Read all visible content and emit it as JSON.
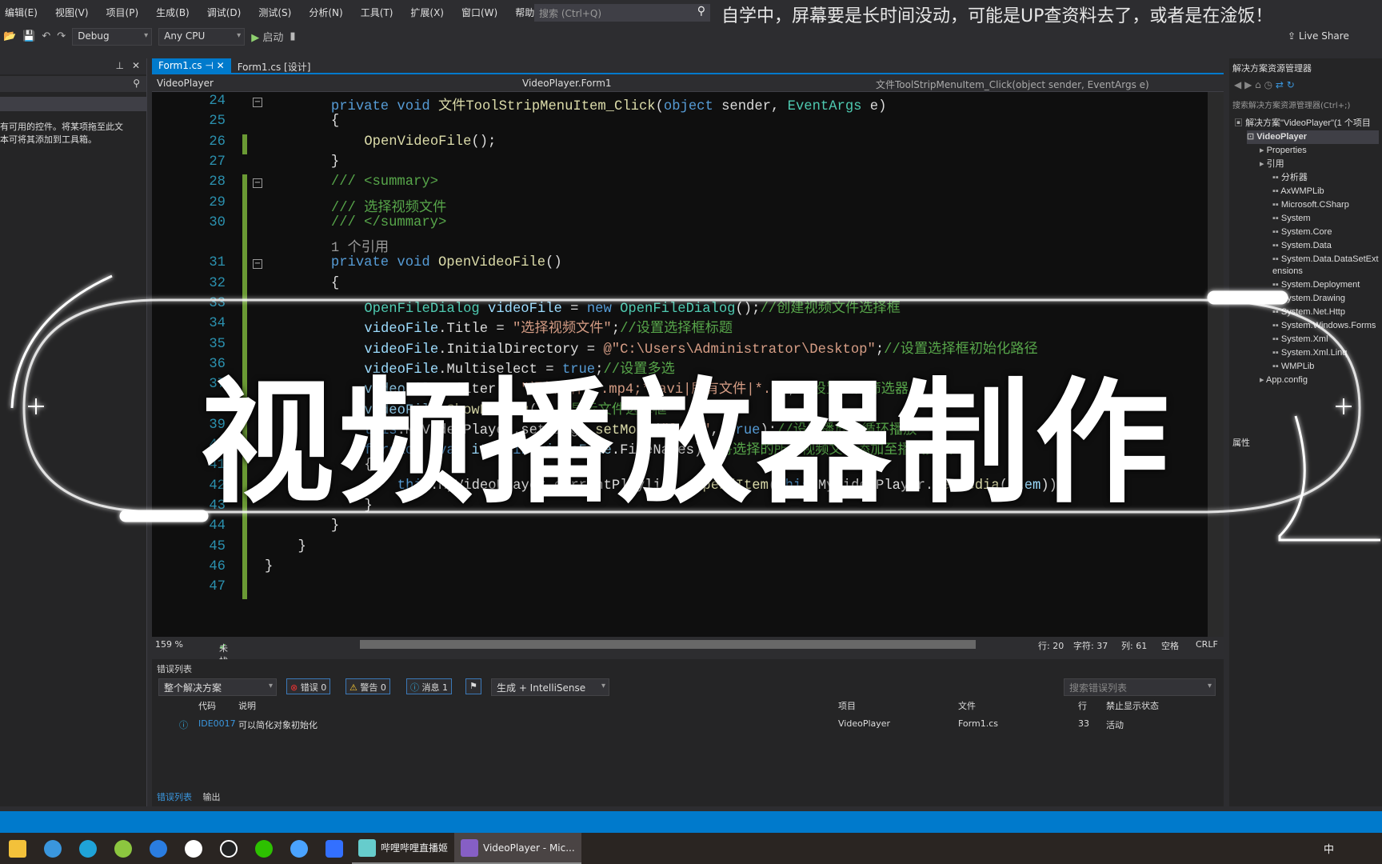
{
  "menu": [
    "编辑(E)",
    "视图(V)",
    "项目(P)",
    "生成(B)",
    "调试(D)",
    "测试(S)",
    "分析(N)",
    "工具(T)",
    "扩展(X)",
    "窗口(W)",
    "帮助(H)"
  ],
  "search": {
    "placeholder": "搜索 (Ctrl+Q)",
    "icon": "search-icon"
  },
  "banner": "自学中，屏幕要是长时间没动，可能是UP查资料去了，或者是在淦饭！",
  "toolbar": {
    "config": "Debug",
    "platform": "Any CPU",
    "start": "启动",
    "live_share": "Live Share"
  },
  "left_panel": {
    "message": [
      "有可用的控件。将某项拖至此文",
      "本可将其添加到工具箱。"
    ]
  },
  "tabs": [
    {
      "label": "Form1.cs",
      "active": true
    },
    {
      "label": "Form1.cs [设计]",
      "active": false
    }
  ],
  "nav": {
    "project": "VideoPlayer",
    "class": "VideoPlayer.Form1",
    "member": "文件ToolStripMenuItem_Click(object sender, EventArgs e)"
  },
  "code": [
    {
      "n": "24",
      "i": 8,
      "t": [
        [
          "private void ",
          "k"
        ],
        [
          "文件ToolStripMenuItem_Click",
          "m"
        ],
        [
          "(",
          "p"
        ],
        [
          "object ",
          "k"
        ],
        [
          "sender, ",
          "p"
        ],
        [
          "EventArgs ",
          "ty"
        ],
        [
          "e)",
          "p"
        ]
      ]
    },
    {
      "n": "25",
      "i": 8,
      "t": [
        [
          "{",
          "p"
        ]
      ]
    },
    {
      "n": "26",
      "i": 12,
      "t": [
        [
          "OpenVideoFile",
          "m"
        ],
        [
          "();",
          "p"
        ]
      ]
    },
    {
      "n": "27",
      "i": 8,
      "t": [
        [
          "}",
          "p"
        ]
      ]
    },
    {
      "n": "28",
      "i": 8,
      "t": [
        [
          "/// <summary>",
          "c"
        ]
      ]
    },
    {
      "n": "29",
      "i": 8,
      "t": [
        [
          "/// 选择视频文件",
          "c"
        ]
      ]
    },
    {
      "n": "30",
      "i": 8,
      "t": [
        [
          "/// </summary>",
          "c"
        ]
      ]
    },
    {
      "n": "",
      "i": 8,
      "t": [
        [
          "1 个引用",
          "g"
        ]
      ]
    },
    {
      "n": "31",
      "i": 8,
      "t": [
        [
          "private void ",
          "k"
        ],
        [
          "OpenVideoFile",
          "m"
        ],
        [
          "()",
          "p"
        ]
      ]
    },
    {
      "n": "32",
      "i": 8,
      "t": [
        [
          "{",
          "p"
        ]
      ]
    },
    {
      "n": "33",
      "i": 12,
      "t": [
        [
          "OpenFileDialog ",
          "ty"
        ],
        [
          "videoFile",
          "v"
        ],
        [
          " = ",
          "p"
        ],
        [
          "new ",
          "k"
        ],
        [
          "OpenFileDialog",
          "ty"
        ],
        [
          "();",
          "p"
        ],
        [
          "//创建视频文件选择框",
          "c"
        ]
      ]
    },
    {
      "n": "34",
      "i": 12,
      "t": [
        [
          "videoFile",
          "v"
        ],
        [
          ".Title = ",
          "p"
        ],
        [
          "\"选择视频文件\"",
          "s"
        ],
        [
          ";",
          "p"
        ],
        [
          "//设置选择框标题",
          "c"
        ]
      ]
    },
    {
      "n": "35",
      "i": 12,
      "t": [
        [
          "videoFile",
          "v"
        ],
        [
          ".InitialDirectory = ",
          "p"
        ],
        [
          "@\"C:\\Users\\Administrator\\Desktop\"",
          "s"
        ],
        [
          ";",
          "p"
        ],
        [
          "//设置选择框初始化路径",
          "c"
        ]
      ]
    },
    {
      "n": "36",
      "i": 12,
      "t": [
        [
          "videoFile",
          "v"
        ],
        [
          ".Multiselect = ",
          "p"
        ],
        [
          "true",
          "k"
        ],
        [
          ";",
          "p"
        ],
        [
          "//设置多选",
          "c"
        ]
      ]
    },
    {
      "n": "37",
      "i": 12,
      "t": [
        [
          "videoFile",
          "v"
        ],
        [
          ".Filter = ",
          "p"
        ],
        [
          "\"视频文件|*.mp4;*.avi|所有文件|*.*\"",
          "s"
        ],
        [
          ";",
          "p"
        ],
        [
          "//设置文件筛选器",
          "c"
        ]
      ]
    },
    {
      "n": "38",
      "i": 12,
      "t": [
        [
          "videoFile",
          "v"
        ],
        [
          ".",
          "p"
        ],
        [
          "ShowDialog",
          "m"
        ],
        [
          "();",
          "p"
        ],
        [
          "//显示文件选择框",
          "c"
        ]
      ]
    },
    {
      "n": "39",
      "i": 12,
      "t": [
        [
          "this",
          "k"
        ],
        [
          ".MyVideoPlayer.settings.",
          "p"
        ],
        [
          "setMode",
          "m"
        ],
        [
          "(",
          "p"
        ],
        [
          "\"loop\"",
          "s"
        ],
        [
          ", ",
          "p"
        ],
        [
          "true",
          "k"
        ],
        [
          ");",
          "p"
        ],
        [
          "//设置播放器循环播放",
          "c"
        ]
      ]
    },
    {
      "n": "40",
      "i": 12,
      "t": [
        [
          "foreach ",
          "k"
        ],
        [
          "(",
          "p"
        ],
        [
          "var ",
          "k"
        ],
        [
          "item ",
          "v"
        ],
        [
          "in ",
          "k"
        ],
        [
          "videoFile",
          "v"
        ],
        [
          ".FileNames)",
          "p"
        ],
        [
          "//将选择的所有视频文件添加至播放列表",
          "c"
        ]
      ]
    },
    {
      "n": "41",
      "i": 12,
      "t": [
        [
          "{",
          "p"
        ]
      ]
    },
    {
      "n": "42",
      "i": 16,
      "t": [
        [
          "this",
          "k"
        ],
        [
          ".MyVideoPlayer.currentPlaylist.",
          "p"
        ],
        [
          "appendItem",
          "m"
        ],
        [
          "(",
          "p"
        ],
        [
          "this",
          "k"
        ],
        [
          ".MyVideoPlayer.",
          "p"
        ],
        [
          "newMedia",
          "m"
        ],
        [
          "(",
          "p"
        ],
        [
          "item",
          "v"
        ],
        [
          "));",
          "p"
        ]
      ]
    },
    {
      "n": "43",
      "i": 12,
      "t": [
        [
          "}",
          "p"
        ]
      ]
    },
    {
      "n": "44",
      "i": 8,
      "t": [
        [
          "}",
          "p"
        ]
      ]
    },
    {
      "n": "45",
      "i": 4,
      "t": [
        [
          "}",
          "p"
        ]
      ]
    },
    {
      "n": "46",
      "i": 0,
      "t": [
        [
          "}",
          "p"
        ]
      ]
    },
    {
      "n": "47",
      "i": 0,
      "t": []
    }
  ],
  "overlay_title": "视频播放器制作",
  "editor_status": {
    "zoom": "159 %",
    "issues": "未找到相关问题",
    "row": "行: 20",
    "char": "字符: 37",
    "col": "列: 61",
    "spaces": "空格",
    "eol": "CRLF"
  },
  "error_list": {
    "title": "错误列表",
    "scope": "整个解决方案",
    "errors": "错误 0",
    "warnings": "警告 0",
    "messages": "消息 1",
    "source": "生成 + IntelliSense",
    "search_placeholder": "搜索错误列表",
    "columns": [
      "代码",
      "说明",
      "项目",
      "文件",
      "行",
      "禁止显示状态"
    ],
    "rows": [
      {
        "code": "IDE0017",
        "desc": "可以简化对象初始化",
        "project": "VideoPlayer",
        "file": "Form1.cs",
        "line": "33",
        "state": "活动"
      }
    ]
  },
  "bottom_tabs": [
    "错误列表",
    "输出"
  ],
  "solution_explorer": {
    "title": "解决方案资源管理器",
    "search": "搜索解决方案资源管理器(Ctrl+;)",
    "items": [
      {
        "label": "解决方案\"VideoPlayer\"(1 个项目",
        "lvl": 0
      },
      {
        "label": "VideoPlayer",
        "lvl": 1,
        "bold": true
      },
      {
        "label": "Properties",
        "lvl": 2
      },
      {
        "label": "引用",
        "lvl": 2
      },
      {
        "label": "分析器",
        "lvl": 3
      },
      {
        "label": "AxWMPLib",
        "lvl": 3
      },
      {
        "label": "Microsoft.CSharp",
        "lvl": 3
      },
      {
        "label": "System",
        "lvl": 3
      },
      {
        "label": "System.Core",
        "lvl": 3
      },
      {
        "label": "System.Data",
        "lvl": 3
      },
      {
        "label": "System.Data.DataSetExtensions",
        "lvl": 3
      },
      {
        "label": "System.Deployment",
        "lvl": 3
      },
      {
        "label": "System.Drawing",
        "lvl": 3
      },
      {
        "label": "System.Net.Http",
        "lvl": 3
      },
      {
        "label": "System.Windows.Forms",
        "lvl": 3
      },
      {
        "label": "System.Xml",
        "lvl": 3
      },
      {
        "label": "System.Xml.Linq",
        "lvl": 3
      },
      {
        "label": "WMPLib",
        "lvl": 3
      },
      {
        "label": "App.config",
        "lvl": 2
      }
    ],
    "properties_title": "属性"
  },
  "taskbar": {
    "apps": [
      {
        "label": "哔哩哔哩直播姬"
      },
      {
        "label": "VideoPlayer - Mic..."
      }
    ],
    "ime": "中"
  },
  "colors": {
    "accent": "#007acc",
    "bg": "#1e1e1e"
  }
}
